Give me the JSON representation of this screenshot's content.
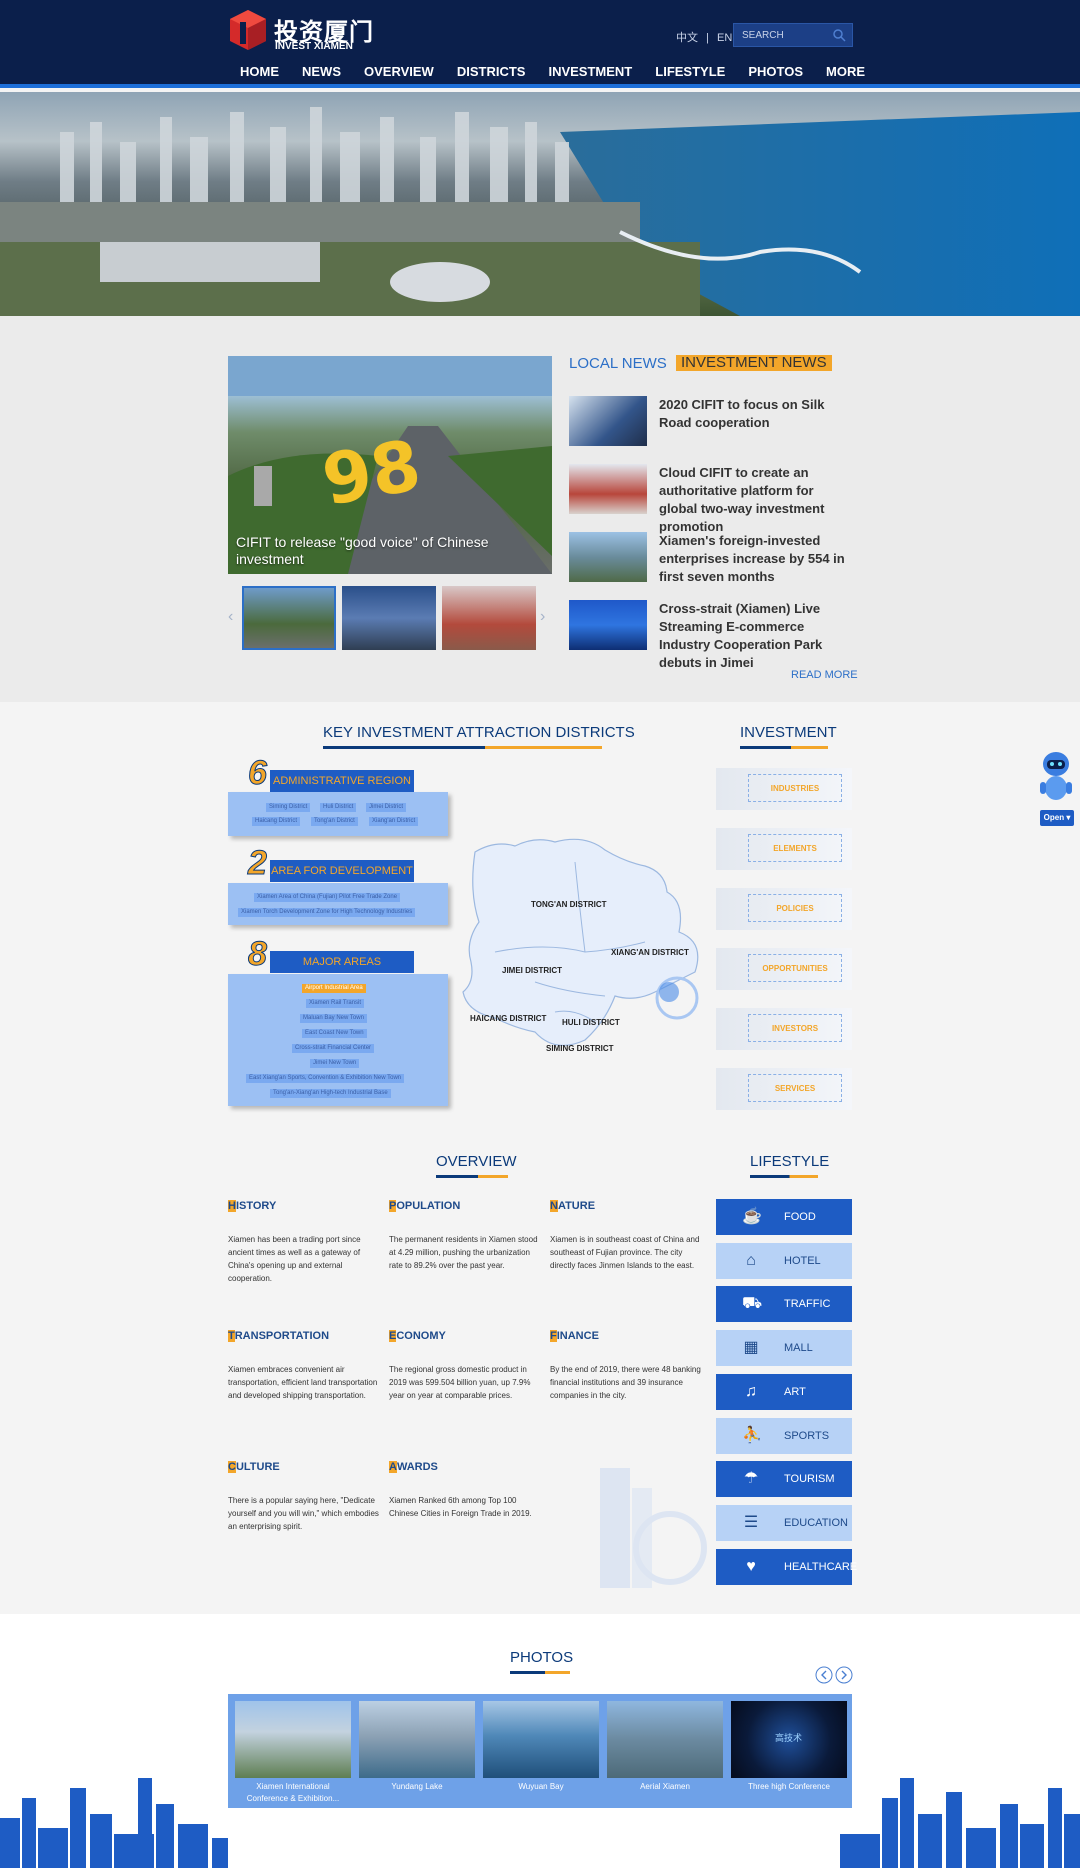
{
  "header": {
    "logo_cn": "投资厦门",
    "logo_en": "INVEST XIAMEN",
    "lang_cn": "中文",
    "lang_sep": "|",
    "lang_en": "EN",
    "search_placeholder": "SEARCH"
  },
  "nav": [
    "HOME",
    "NEWS",
    "OVERVIEW",
    "DISTRICTS",
    "INVESTMENT",
    "LIFESTYLE",
    "PHOTOS",
    "MORE"
  ],
  "news": {
    "feature_caption": "CIFIT to release \"good voice\" of Chinese investment",
    "tab_local": "LOCAL NEWS",
    "tab_investment": "INVESTMENT NEWS",
    "items": [
      "2020 CIFIT to focus on Silk Road cooperation",
      "Cloud CIFIT to create an authoritative platform for global two-way investment promotion",
      "Xiamen's foreign-invested enterprises increase by 554 in first seven months",
      "Cross-strait (Xiamen) Live Streaming E-commerce Industry Cooperation Park debuts in Jimei"
    ],
    "read_more": "READ MORE"
  },
  "districts": {
    "title": "KEY INVESTMENT ATTRACTION DISTRICTS",
    "admin": {
      "num": "6",
      "title": "ADMINISTRATIVE REGION",
      "tags": [
        "Siming District",
        "Huli District",
        "Jimei District",
        "Haicang District",
        "Tong'an District",
        "Xiang'an District"
      ]
    },
    "dev": {
      "num": "2",
      "title": "AREA FOR DEVELOPMENT",
      "tags": [
        "Xiamen Area of China (Fujian) Pilot Free Trade Zone",
        "Xiamen Torch Development Zone for High Technology Industries"
      ]
    },
    "major": {
      "num": "8",
      "title": "MAJOR AREAS",
      "tags": [
        "Airport Industrial Area",
        "Xiamen Rail Transit",
        "Maluan Bay New Town",
        "East Coast New Town",
        "Cross-strait Financial Center",
        "Jimei New Town",
        "East Xiang'an Sports, Convention & Exhibition New Town",
        "Tong'an-Xiang'an High-tech Industrial Base"
      ]
    },
    "map_labels": [
      "TONG'AN DISTRICT",
      "XIANG'AN DISTRICT",
      "JIMEI DISTRICT",
      "HAICANG DISTRICT",
      "HULI DISTRICT",
      "SIMING DISTRICT"
    ]
  },
  "investment": {
    "title": "INVESTMENT",
    "items": [
      "INDUSTRIES",
      "ELEMENTS",
      "POLICIES",
      "OPPORTUNITIES",
      "INVESTORS",
      "SERVICES"
    ]
  },
  "overview": {
    "title": "OVERVIEW",
    "items": [
      {
        "first": "H",
        "rest": "ISTORY",
        "text": "Xiamen has been a trading port since ancient times as well as a gateway of China's opening up and external cooperation."
      },
      {
        "first": "P",
        "rest": "OPULATION",
        "text": "The permanent residents in Xiamen stood at 4.29 million, pushing the urbanization rate to 89.2% over the past year."
      },
      {
        "first": "N",
        "rest": "ATURE",
        "text": "Xiamen is in southeast coast of China and southeast of Fujian province. The city directly faces Jinmen Islands to the east."
      },
      {
        "first": "T",
        "rest": "RANSPORTATION",
        "text": "Xiamen embraces convenient air transportation, efficient land transportation and developed shipping transportation."
      },
      {
        "first": "E",
        "rest": "CONOMY",
        "text": "The regional gross domestic product in 2019 was 599.504 billion yuan, up 7.9% year on year at comparable prices."
      },
      {
        "first": "F",
        "rest": "INANCE",
        "text": "By the end of 2019, there were 48 banking financial institutions and 39 insurance companies in the city."
      },
      {
        "first": "C",
        "rest": "ULTURE",
        "text": "There is a popular saying here, \"Dedicate yourself and you will win,\" which embodies an enterprising spirit."
      },
      {
        "first": "A",
        "rest": "WARDS",
        "text": "Xiamen Ranked 6th among Top 100 Chinese Cities in Foreign Trade in 2019."
      }
    ]
  },
  "lifestyle": {
    "title": "LIFESTYLE",
    "items": [
      "FOOD",
      "HOTEL",
      "TRAFFIC",
      "MALL",
      "ART",
      "SPORTS",
      "TOURISM",
      "EDUCATION",
      "HEALTHCARE"
    ]
  },
  "photos": {
    "title": "PHOTOS",
    "items": [
      "Xiamen International Conference & Exhibition...",
      "Yundang Lake",
      "Wuyuan Bay",
      "Aerial Xiamen",
      "Three high Conference"
    ],
    "last_overlay": "高技术"
  },
  "widget": {
    "open_label": "Open ▾"
  }
}
